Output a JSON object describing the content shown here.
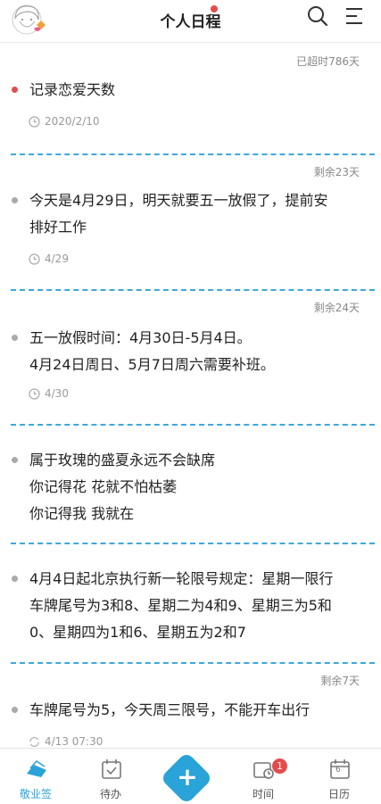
{
  "header": {
    "title": "个人日程",
    "avatar": "avatar-girl-with-heart",
    "icons": [
      "search-icon",
      "menu-icon"
    ]
  },
  "items": [
    {
      "remain": "已超时786天",
      "text_lines": [
        "记录恋爱天数"
      ],
      "meta": "2020/2/10",
      "meta_icon": "clock-icon",
      "bullet": "red"
    },
    {
      "remain": "剩余23天",
      "text_lines": [
        "今天是4月29日，明天就要五一放假了，提前安",
        "排好工作"
      ],
      "meta": "4/29",
      "meta_icon": "clock-icon",
      "bullet": "gray"
    },
    {
      "remain": "剩余24天",
      "text_lines": [
        "五一放假时间：4月30日-5月4日。",
        "4月24日周日、5月7日周六需要补班。"
      ],
      "meta": "4/30",
      "meta_icon": "clock-icon",
      "bullet": "gray"
    },
    {
      "remain": "",
      "text_lines": [
        "属于玫瑰的盛夏永远不会缺席",
        "你记得花 花就不怕枯萎",
        "你记得我 我就在"
      ],
      "meta": "",
      "bullet": "gray"
    },
    {
      "remain": "",
      "text_lines": [
        "4月4日起北京执行新一轮限号规定：星期一限行",
        "车牌尾号为3和8、星期二为4和9、星期三为5和",
        "0、星期四为1和6、星期五为2和7"
      ],
      "meta": "",
      "bullet": "gray"
    },
    {
      "remain": "剩余7天",
      "text_lines": [
        "车牌尾号为5，今天周三限号，不能开车出行"
      ],
      "meta": "4/13 07:30",
      "meta_icon": "repeat-icon",
      "bullet": "gray"
    }
  ],
  "bottom_nav": {
    "tabs": [
      {
        "label": "敬业签",
        "icon": "note-icon",
        "active": true
      },
      {
        "label": "待办",
        "icon": "todo-icon",
        "active": false
      },
      {
        "label": "",
        "icon": "add-icon",
        "active": false
      },
      {
        "label": "时间",
        "icon": "time-icon",
        "active": false,
        "badge": "1"
      },
      {
        "label": "日历",
        "icon": "calendar-icon",
        "active": false,
        "day": "6"
      }
    ]
  },
  "colors": {
    "accent": "#2aa3d8",
    "alert": "#e54b4b",
    "divider": "#3fa7de"
  }
}
